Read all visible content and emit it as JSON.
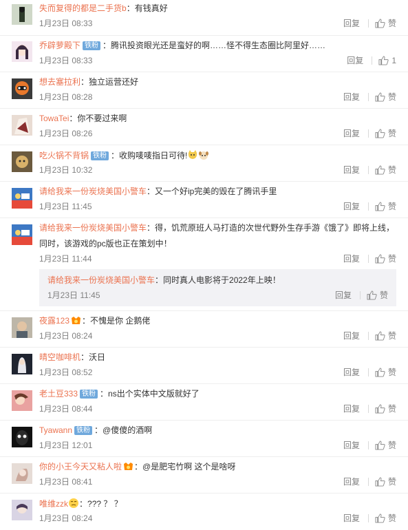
{
  "labels": {
    "reply": "回复",
    "like": "赞"
  },
  "colors": {
    "username": "#eb7350",
    "meta": "#808080",
    "badge": "#6fa8dc",
    "subreply_bg": "#f2f2f5"
  },
  "comments": [
    {
      "username": "失而复得的都是二手货b",
      "text": "：有钱真好",
      "time": "1月23日 08:33",
      "likes": "赞"
    },
    {
      "username": "乔辟萝殿下",
      "badge": "铁粉",
      "text": "：腾讯投资眼光还是蛮好的啊……怪不得生态圈比阿里好……",
      "time": "1月23日 08:33",
      "likes": "1"
    },
    {
      "username": "想去塞拉利",
      "text": "：独立运营还好",
      "time": "1月23日 08:28",
      "likes": "赞"
    },
    {
      "username": "TowaTei",
      "text": "：你不要过来啊",
      "time": "1月23日 08:26",
      "likes": "赞"
    },
    {
      "username": "吃火锅不背锅",
      "badge": "铁粉",
      "text": "：收购唛唛指日可待!",
      "time": "1月23日 10:32",
      "likes": "赞"
    },
    {
      "username": "请给我来一份炭烧美国小警车",
      "text": "：又一个好ip完美的毁在了腾讯手里",
      "time": "1月23日 11:45",
      "likes": "赞"
    },
    {
      "username": "请给我来一份炭烧美国小警车",
      "text": "：得，饥荒原班人马打造的次世代野外生存手游《饿了》即将上线，",
      "text2": "同时，该游戏的pc版也正在策划中！",
      "time": "1月23日 11:44",
      "likes": "赞",
      "sub": {
        "username": "请给我来一份炭烧美国小警车",
        "text": "：同时真人电影将于2022年上映！",
        "time": "1月23日 11:45",
        "likes": "赞"
      }
    },
    {
      "username": "夜露123",
      "text": "：不愧是你 企鹅佬",
      "time": "1月23日 08:24",
      "likes": "赞"
    },
    {
      "username": "晴空咖啡机",
      "text": "：沃日",
      "time": "1月23日 08:52",
      "likes": "赞"
    },
    {
      "username": "老土豆333",
      "badge": "铁粉",
      "text": "：ns出个实体中文版就好了",
      "time": "1月23日 08:44",
      "likes": "赞"
    },
    {
      "username": "Tyawann",
      "badge": "铁粉",
      "text": "：@傻傻的酒啊",
      "time": "1月23日 12:01",
      "likes": "赞"
    },
    {
      "username": "你的小王今天又粘人啦",
      "text": "：@是肥宅竹啊 这个是啥呀",
      "time": "1月23日 08:41",
      "likes": "赞"
    },
    {
      "username": "唯维zzk",
      "text": "：??? ？ ？",
      "time": "1月23日 08:24",
      "likes": "赞"
    }
  ]
}
